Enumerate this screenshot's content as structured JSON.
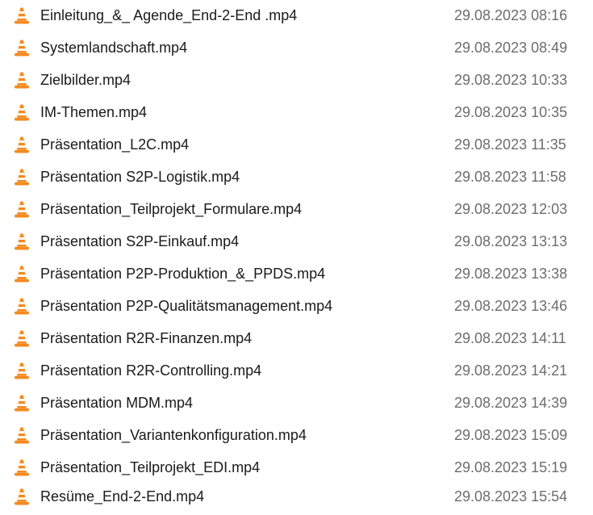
{
  "file_list": {
    "rows": [
      {
        "name": "Einleitung_&_ Agende_End-2-End .mp4",
        "modified": "29.08.2023 08:16",
        "icon": "vlc-media-file-icon"
      },
      {
        "name": "Systemlandschaft.mp4",
        "modified": "29.08.2023 08:49",
        "icon": "vlc-media-file-icon"
      },
      {
        "name": "Zielbilder.mp4",
        "modified": "29.08.2023 10:33",
        "icon": "vlc-media-file-icon"
      },
      {
        "name": "IM-Themen.mp4",
        "modified": "29.08.2023 10:35",
        "icon": "vlc-media-file-icon"
      },
      {
        "name": "Präsentation_L2C.mp4",
        "modified": "29.08.2023 11:35",
        "icon": "vlc-media-file-icon"
      },
      {
        "name": "Präsentation S2P-Logistik.mp4",
        "modified": "29.08.2023 11:58",
        "icon": "vlc-media-file-icon"
      },
      {
        "name": "Präsentation_Teilprojekt_Formulare.mp4",
        "modified": "29.08.2023 12:03",
        "icon": "vlc-media-file-icon"
      },
      {
        "name": "Präsentation S2P-Einkauf.mp4",
        "modified": "29.08.2023 13:13",
        "icon": "vlc-media-file-icon"
      },
      {
        "name": "Präsentation P2P-Produktion_&_PPDS.mp4",
        "modified": "29.08.2023 13:38",
        "icon": "vlc-media-file-icon"
      },
      {
        "name": "Präsentation P2P-Qualitätsmanagement.mp4",
        "modified": "29.08.2023 13:46",
        "icon": "vlc-media-file-icon"
      },
      {
        "name": "Präsentation R2R-Finanzen.mp4",
        "modified": "29.08.2023 14:11",
        "icon": "vlc-media-file-icon"
      },
      {
        "name": "Präsentation R2R-Controlling.mp4",
        "modified": "29.08.2023 14:21",
        "icon": "vlc-media-file-icon"
      },
      {
        "name": "Präsentation MDM.mp4",
        "modified": "29.08.2023 14:39",
        "icon": "vlc-media-file-icon"
      },
      {
        "name": "Präsentation_Variantenkonfiguration.mp4",
        "modified": "29.08.2023 15:09",
        "icon": "vlc-media-file-icon"
      },
      {
        "name": "Präsentation_Teilprojekt_EDI.mp4",
        "modified": "29.08.2023 15:19",
        "icon": "vlc-media-file-icon"
      },
      {
        "name": "Resüme_End-2-End.mp4",
        "modified": "29.08.2023 15:54",
        "icon": "vlc-media-file-icon"
      }
    ]
  },
  "colors": {
    "file_name_text": "#1a1a1a",
    "date_text": "#6d6d6d",
    "icon_orange": "#f58a1f",
    "icon_stripe": "#ffffff"
  }
}
